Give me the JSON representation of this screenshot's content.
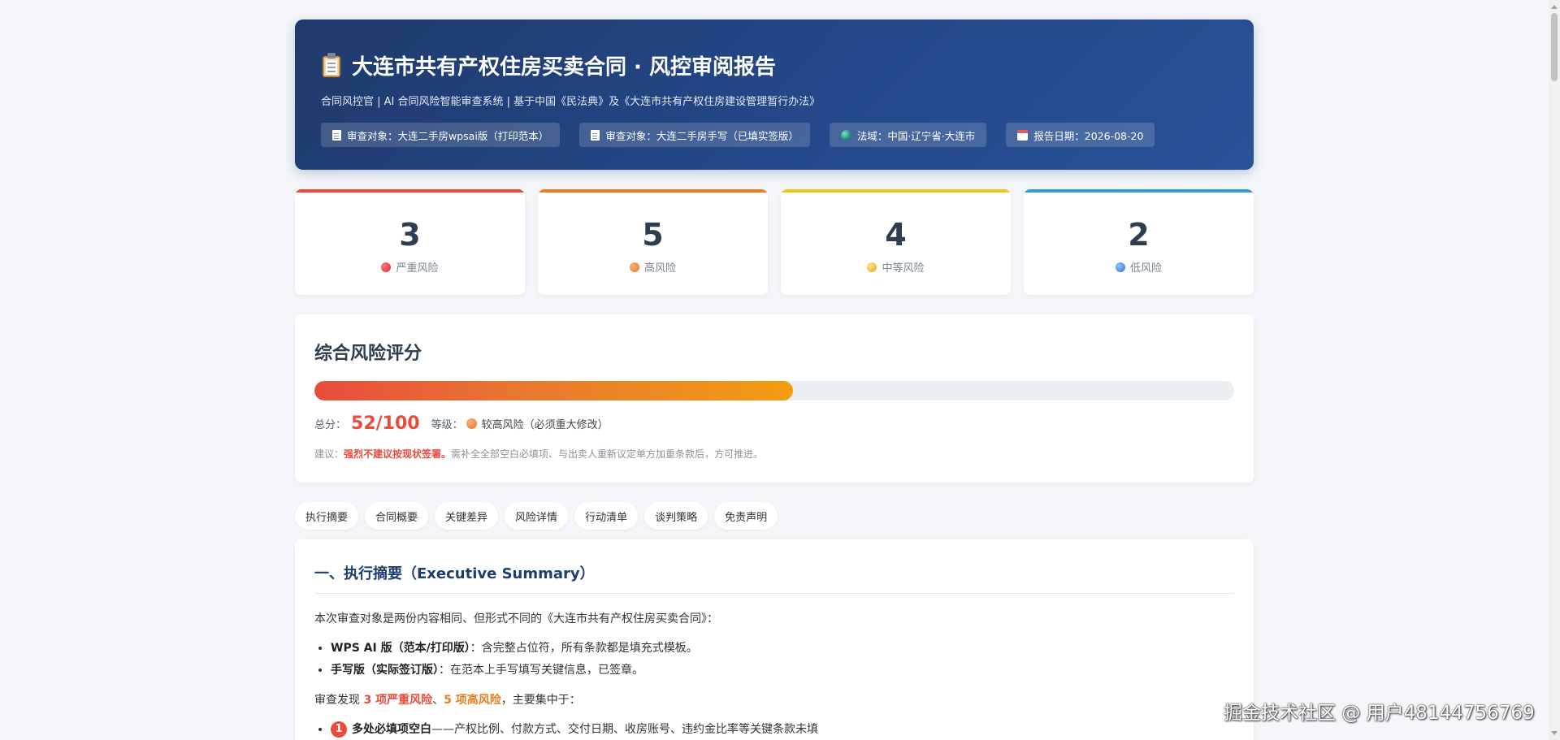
{
  "header": {
    "title": "大连市共有产权住房买卖合同 · 风控审阅报告",
    "icon": "clipboard-icon",
    "subtitle": "合同风控官 | AI 合同风险智能审查系统 | 基于中国《民法典》及《大连市共有产权住房建设管理暂行办法》",
    "tags": [
      {
        "icon": "document-icon",
        "text": "审查对象：大连二手房wpsai版（打印范本）"
      },
      {
        "icon": "document-icon",
        "text": "审查对象：大连二手房手写（已填实签版）"
      },
      {
        "icon": "globe-icon",
        "text": "法域：中国·辽宁省·大连市"
      },
      {
        "icon": "calendar-icon",
        "text": "报告日期：2026-08-20"
      }
    ]
  },
  "stats": [
    {
      "value": "3",
      "label": "严重风险",
      "color": "#e74c3c"
    },
    {
      "value": "5",
      "label": "高风险",
      "color": "#e67e22"
    },
    {
      "value": "4",
      "label": "中等风险",
      "color": "#f1c40f"
    },
    {
      "value": "2",
      "label": "低风险",
      "color": "#3498db"
    }
  ],
  "score": {
    "title": "综合风险评分",
    "progress": 0.52,
    "total_label": "总分：",
    "total_value": "52/100",
    "grade_label": "等级：",
    "grade_value": "较高风险（必须重大修改）",
    "advice_label": "建议：",
    "advice_strong": "强烈不建议按现状签署。",
    "advice_text": "需补全全部空白必填项、与出卖人重新议定单方加重条款后，方可推进。"
  },
  "nav": [
    "执行摘要",
    "合同概要",
    "关键差异",
    "风险详情",
    "行动清单",
    "谈判策略",
    "免责声明"
  ],
  "summary": {
    "title": "一、执行摘要（Executive Summary）",
    "intro": "本次审查对象是两份内容相同、但形式不同的《大连市共有产权住房买卖合同》：",
    "items": [
      {
        "bold": "WPS AI 版（范本/打印版）",
        "text": "：含完整占位符，所有条款都是填充式模板。"
      },
      {
        "bold": "手写版（实际签订版）",
        "text": "：在范本上手写填写关键信息，已签章。"
      }
    ],
    "findings_pre": "审查发现 ",
    "findings_severe": "3 项严重风险",
    "findings_sep": "、",
    "findings_high": "5 项高风险",
    "findings_post": "，主要集中于：",
    "first_finding_num": "1",
    "first_finding_bold": "多处必填项空白",
    "first_finding_text": "——产权比例、付款方式、交付日期、收房账号、违约金比率等关键条款未填"
  },
  "watermark": "掘金技术社区 @ 用户4814475676​9"
}
